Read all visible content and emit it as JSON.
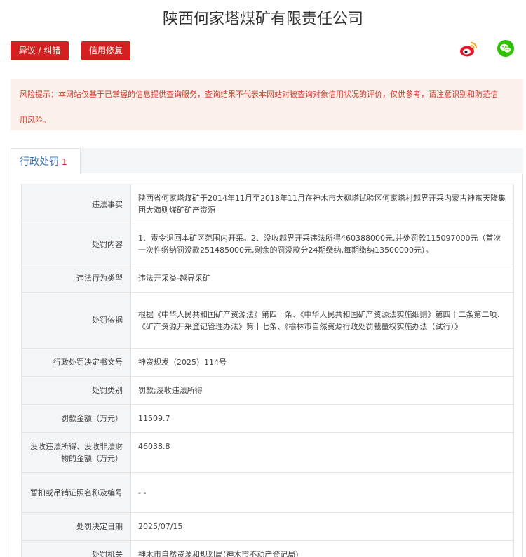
{
  "company_name": "陕西何家塔煤矿有限责任公司",
  "buttons": {
    "objection": "异议 / 纠错",
    "credit_repair": "信用修复"
  },
  "share_icons": [
    "weibo-icon",
    "wechat-icon"
  ],
  "notice": {
    "label": "风险提示：",
    "line1": "本网站仅基于已掌握的信息提供查询服务，查询结果不代表本网站对被查询对象信用状况的评价，仅供参考，请注意识别和防范信",
    "line2": "用风险。"
  },
  "tab": {
    "label": "行政处罚",
    "count": "1"
  },
  "record": [
    {
      "key": "违法事实",
      "value": "陕西省何家塔煤矿于2014年11月至2018年11月在神木市大柳塔试验区何家塔村越界开采内蒙古神东天隆集团大海则煤矿矿产资源"
    },
    {
      "key": "处罚内容",
      "value": "1、责令退回本矿区范围内开采。2、没收越界开采违法所得460388000元,并处罚款115097000元（首次一次性缴纳罚没款251485000元,剩余的罚没款分24期缴纳,每期缴纳13500000元）。"
    },
    {
      "key": "违法行为类型",
      "value": "违法开采类-越界采矿"
    },
    {
      "key": "处罚依据",
      "value": "根据《中华人民共和国矿产资源法》第四十条、《中华人民共和国矿产资源法实施细则》第四十二条第二项、《矿产资源开采登记管理办法》第十七条、《榆林市自然资源行政处罚裁量权实施办法（试行）》"
    },
    {
      "key": "行政处罚决定书文号",
      "value": "神资规发（2025）114号"
    },
    {
      "key": "处罚类别",
      "value": "罚款;没收违法所得"
    },
    {
      "key": "罚款金额（万元）",
      "value": "11509.7"
    },
    {
      "key": "没收违法所得、没收非法财物的金额（万元）",
      "value": "46038.8"
    },
    {
      "key": "暂扣或吊销证照名称及编号",
      "value": "- -"
    },
    {
      "key": "处罚决定日期",
      "value": "2025/07/15"
    },
    {
      "key": "处罚机关",
      "value": "神木市自然资源和规划局(神木市不动产登记局)"
    }
  ],
  "colors": {
    "accent_red": "#d42020",
    "notice_text": "#d83b2a",
    "notice_bg": "#fbf0ec",
    "tab_blue": "#3a6fb0",
    "wechat_green": "#2dc100"
  }
}
